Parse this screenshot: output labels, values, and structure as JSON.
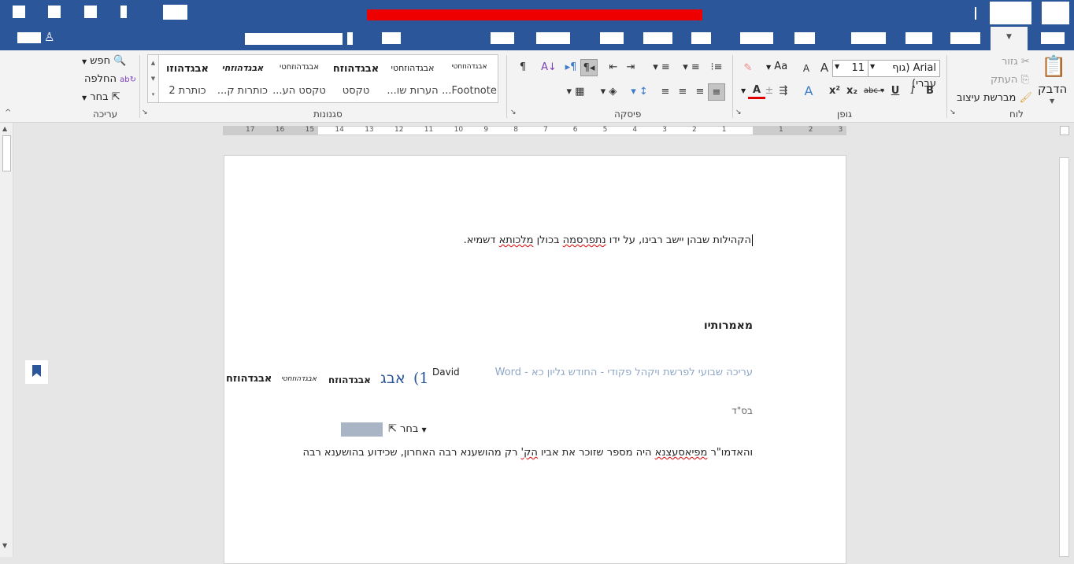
{
  "ribbon": {
    "clipboard": {
      "paste": "הדבק",
      "cut": "גזור",
      "copy": "העתק",
      "format_painter": "מברשת עיצוב",
      "label": "לוח"
    },
    "font": {
      "name": "Arial (גוף עברי)",
      "size": "11",
      "change_case": "Aa",
      "label": "גופן"
    },
    "paragraph": {
      "label": "פיסקה"
    },
    "styles": {
      "label": "סגנונות",
      "items": [
        {
          "preview": "אבגדהוזחטי",
          "name": "Footnote..."
        },
        {
          "preview": "אבגדהוזחטי",
          "name": "הערות שו..."
        },
        {
          "preview": "אבגדהוזח",
          "name": "טקסט"
        },
        {
          "preview": "אבגדהוזחטי",
          "name": "טקסט הע..."
        },
        {
          "preview": "אבגדהוזחי",
          "name": "כותרות ק..."
        },
        {
          "preview": "אבגדהוזו",
          "name": "כותרת 2"
        }
      ]
    },
    "editing": {
      "find": "חפש",
      "replace": "החלפה",
      "select": "בחר",
      "label": "עריכה"
    }
  },
  "ruler": {
    "left_numbers": [
      "17",
      "16",
      "15",
      "14",
      "13",
      "12",
      "11",
      "10",
      "9",
      "8",
      "7",
      "6",
      "5",
      "4",
      "3",
      "2",
      "1"
    ],
    "right_numbers": [
      "1",
      "2",
      "3"
    ]
  },
  "document": {
    "line1": "הקהילות שבהן יישב רבינו, על ידו ",
    "line1_sq1": "נתפרסמה",
    "line1_mid": " בכולן ",
    "line1_sq2": "מלכותא",
    "line1_end": " דשמיא.",
    "heading": "מאמרותיו",
    "header_text": "עריכה שבועי לפרשת ויקהל פקודי - החודש גליון כא  -  Word",
    "font_label": "David",
    "paren": "(1",
    "preview_abc": "אבג",
    "preview1": "אבגדהוזח",
    "preview2": "אבגדהוזחטי",
    "preview3": "אבגדהוזח",
    "bsd": "בס\"ד",
    "select_ghost": "בחר",
    "body_start": "והאדמו\"ר ",
    "body_sq1": "מפיאסעצנא",
    "body_mid": " היה מספר שזוכר את אביו ",
    "body_sq2": "הק'",
    "body_end": " רק מהושענא רבה האחרון, שכידוע בהושענא רבה"
  },
  "colors": {
    "titlebar": "#2b579a",
    "title_highlight": "#ee0000",
    "font_color": "#e00000"
  }
}
